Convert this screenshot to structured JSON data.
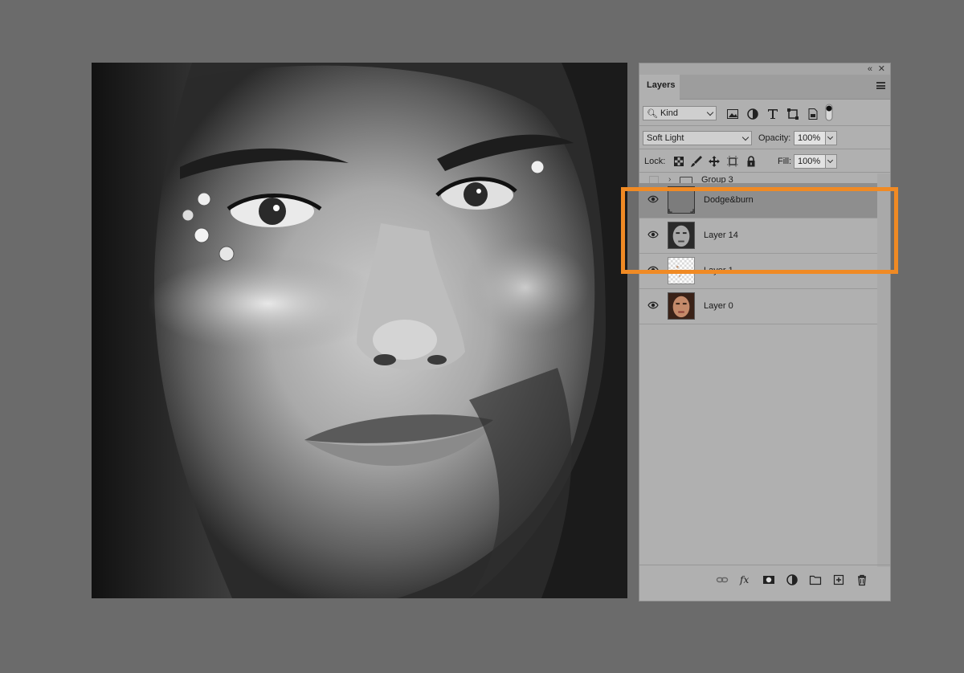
{
  "panel": {
    "tab_label": "Layers",
    "filter": {
      "label": "Kind"
    },
    "blend_mode": "Soft Light",
    "opacity": {
      "label": "Opacity:",
      "value": "100%"
    },
    "lock": {
      "label": "Lock:"
    },
    "fill": {
      "label": "Fill:",
      "value": "100%"
    },
    "group_name": "Group 3",
    "layers": [
      {
        "name": "Dodge&burn",
        "selected": true,
        "visible": true,
        "thumb": "gray-fill"
      },
      {
        "name": "Layer 14",
        "selected": false,
        "visible": true,
        "thumb": "bw-portrait"
      },
      {
        "name": "Layer 1",
        "selected": false,
        "visible": true,
        "thumb": "transparent-pattern"
      },
      {
        "name": "Layer 0",
        "selected": false,
        "visible": true,
        "thumb": "color-portrait"
      }
    ]
  },
  "colors": {
    "highlight": "#f08a24",
    "background": "#6b6b6b",
    "panel": "#b0b0b0",
    "selected_row": "#8e8e8e"
  }
}
